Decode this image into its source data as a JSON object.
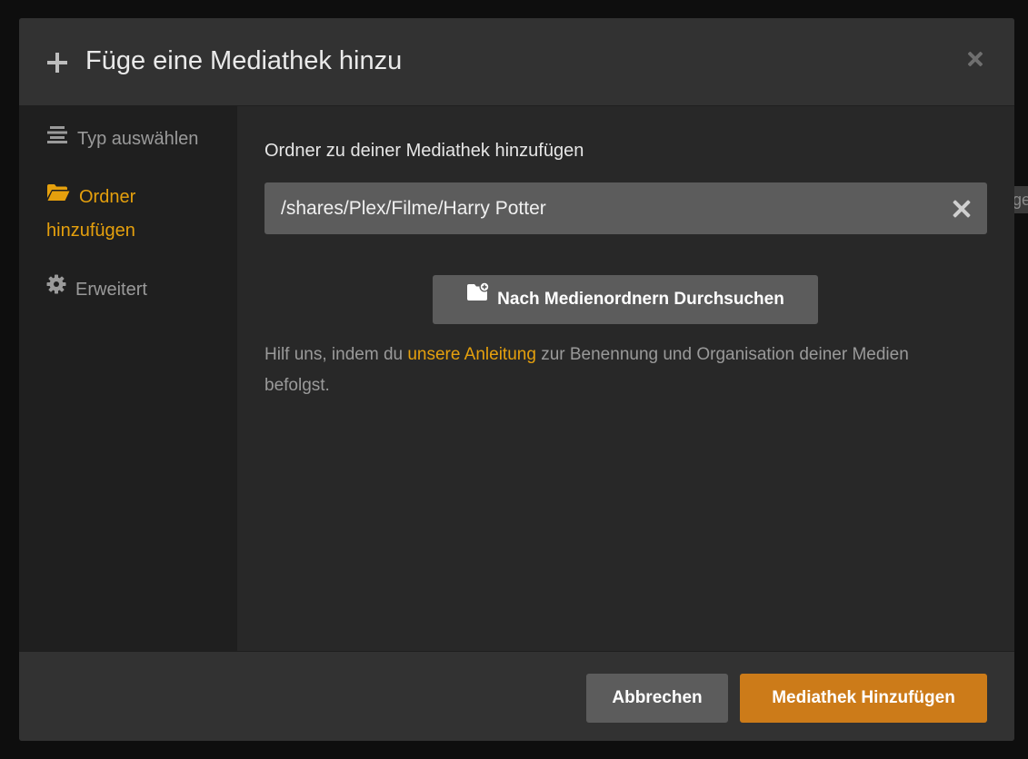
{
  "modal": {
    "title": "Füge eine Mediathek hinzu",
    "header_icon": "plus-icon",
    "close_icon": "close-icon"
  },
  "sidebar": {
    "items": [
      {
        "label": "Typ auswählen",
        "icon": "list-icon",
        "active": false
      },
      {
        "label": "Ordner hinzufügen",
        "icon": "folder-open-icon",
        "active": true
      },
      {
        "label": "Erweitert",
        "icon": "gear-icon",
        "active": false
      }
    ]
  },
  "main": {
    "section_label": "Ordner zu deiner Mediathek hinzufügen",
    "path_value": "/shares/Plex/Filme/Harry Potter",
    "browse_button_label": "Nach Medienordnern Durchsuchen",
    "browse_button_icon": "folder-add-icon",
    "help_prefix": "Hilf uns, indem du ",
    "help_link": "unsere Anleitung",
    "help_suffix": " zur Benennung und Organisation deiner Medien befolgst."
  },
  "footer": {
    "cancel_label": "Abbrechen",
    "add_label": "Mediathek Hinzufügen"
  },
  "background": {
    "edge_fragment": "ge"
  },
  "colors": {
    "accent": "#e5a00d",
    "primary_button": "#cc7b19",
    "secondary_button": "#5c5c5c",
    "modal_bg": "#282828",
    "sidebar_bg": "#1f1f1f"
  }
}
